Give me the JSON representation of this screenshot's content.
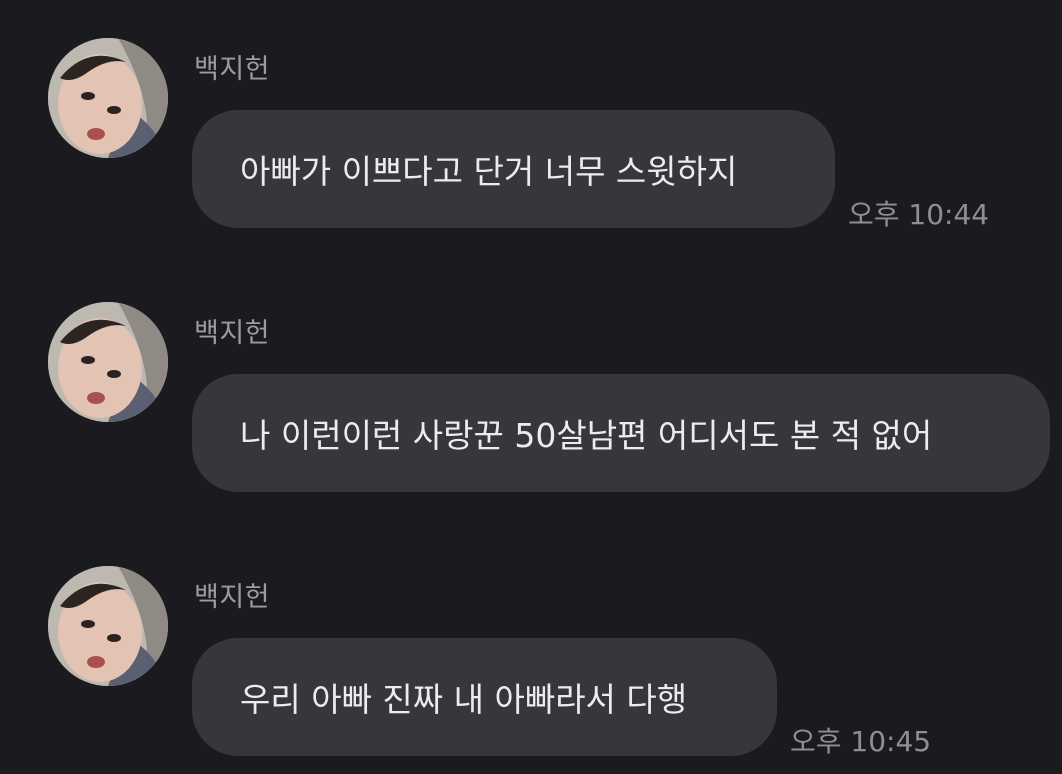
{
  "messages": [
    {
      "sender": "백지헌",
      "text": "아빠가 이쁘다고 단거 너무 스윗하지",
      "time": "오후 10:44"
    },
    {
      "sender": "백지헌",
      "text": "나 이런이런 사랑꾼 50살남편 어디서도 본 적 없어",
      "time": ""
    },
    {
      "sender": "백지헌",
      "text": "우리 아빠 진짜 내 아빠라서 다행",
      "time": "오후 10:45"
    }
  ]
}
